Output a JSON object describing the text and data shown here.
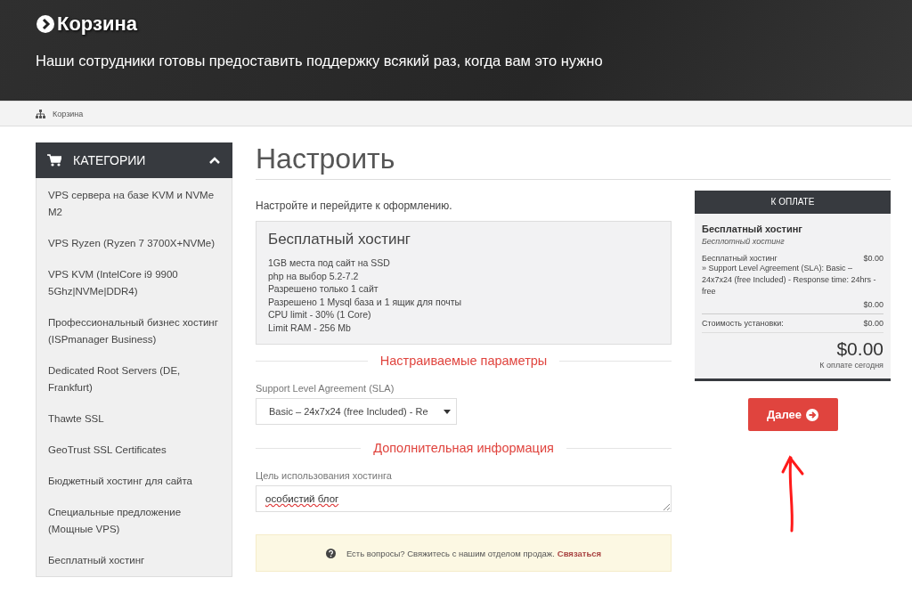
{
  "header": {
    "title": "Корзина",
    "subtitle": "Наши сотрудники готовы предоставить поддержку всякий раз, когда вам это нужно"
  },
  "breadcrumb": [
    "Корзина"
  ],
  "sidebar": {
    "title": "КАТЕГОРИИ",
    "expanded": true,
    "items": [
      "VPS сервера на базе KVM и NVMe M2",
      "VPS Ryzen (Ryzen 7 3700X+NVMe)",
      "VPS KVM (IntelCore i9 9900 5Ghz|NVMe|DDR4)",
      "Профессиональный бизнес хостинг (ISPmanager Business)",
      "Dedicated Root Servers (DE, Frankfurt)",
      "Thawte SSL",
      "GeoTrust SSL Certificates",
      "Бюджетный хостинг для сайта",
      "Специальные предложение (Мощные VPS)",
      "Бесплатный хостинг"
    ]
  },
  "main": {
    "title": "Настроить",
    "intro": "Настройте и перейдите к оформлению.",
    "product": {
      "name": "Бесплатный хостинг",
      "features": [
        "1GB места под сайт на SSD",
        "php на выбор 5.2-7.2",
        "Разрешено только 1 сайт",
        "Разрешено 1 Mysql база и 1 ящик для почты",
        "CPU limit - 30% (1 Core)",
        "Limit RAM - 256 Mb"
      ]
    },
    "sections": [
      {
        "heading": "Настраиваемые параметры",
        "fields": [
          {
            "kind": "select",
            "label": "Support Level Agreement (SLA)",
            "value": "Basic – 24x7x24 (free Included) - Re"
          }
        ]
      },
      {
        "heading": "Дополнительная информация",
        "fields": [
          {
            "kind": "textarea",
            "label": "Цель использования хостинга",
            "value": "особистий блог"
          }
        ]
      }
    ],
    "notice": {
      "text": "Есть вопросы? Свяжитесь с нашим отделом продаж.",
      "link": "Связаться"
    }
  },
  "summary": {
    "header": "К ОПЛАТЕ",
    "product_name": "Бесплатный хостинг",
    "product_group": "Бесплотный хостинг",
    "line": {
      "label": "Бесплатный хостинг",
      "amount": "$0.00",
      "detail": "» Support Level Agreement (SLA): Basic – 24x7x24 (free Included) - Response time: 24hrs - free",
      "detail_amount": "$0.00"
    },
    "setup": {
      "label": "Стоимость установки:",
      "amount": "$0.00"
    },
    "total": "$0.00",
    "total_label": "К оплате сегодня"
  },
  "next_button": "Далее"
}
